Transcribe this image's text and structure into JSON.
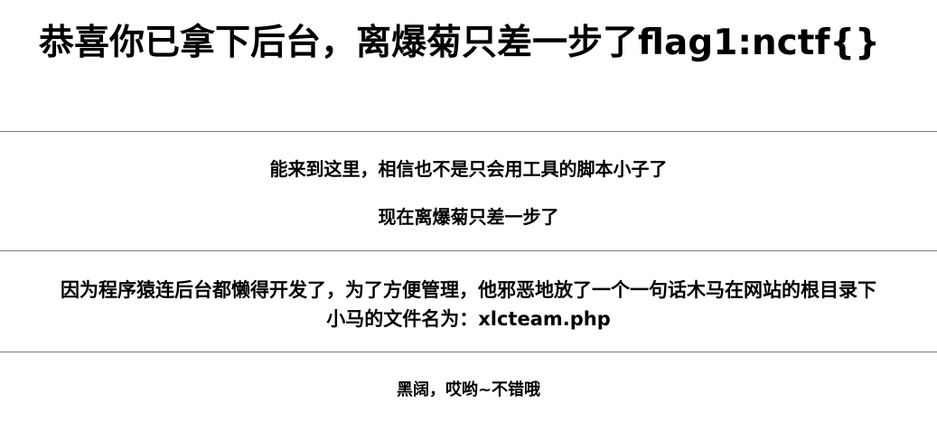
{
  "page": {
    "title": "恭喜你已拿下后台，离爆菊只差一步了flag1:nctf{}"
  },
  "section1": {
    "line1": "能来到这里，相信也不是只会用工具的脚本小子了",
    "line2": "现在离爆菊只差一步了"
  },
  "section2": {
    "line1": "因为程序猿连后台都懒得开发了，为了方便管理，他邪恶地放了一个一句话木马在网站的根目录下",
    "line2": "小马的文件名为：xlcteam.php"
  },
  "section3": {
    "line1": "黑阔，哎哟~不错哦"
  }
}
